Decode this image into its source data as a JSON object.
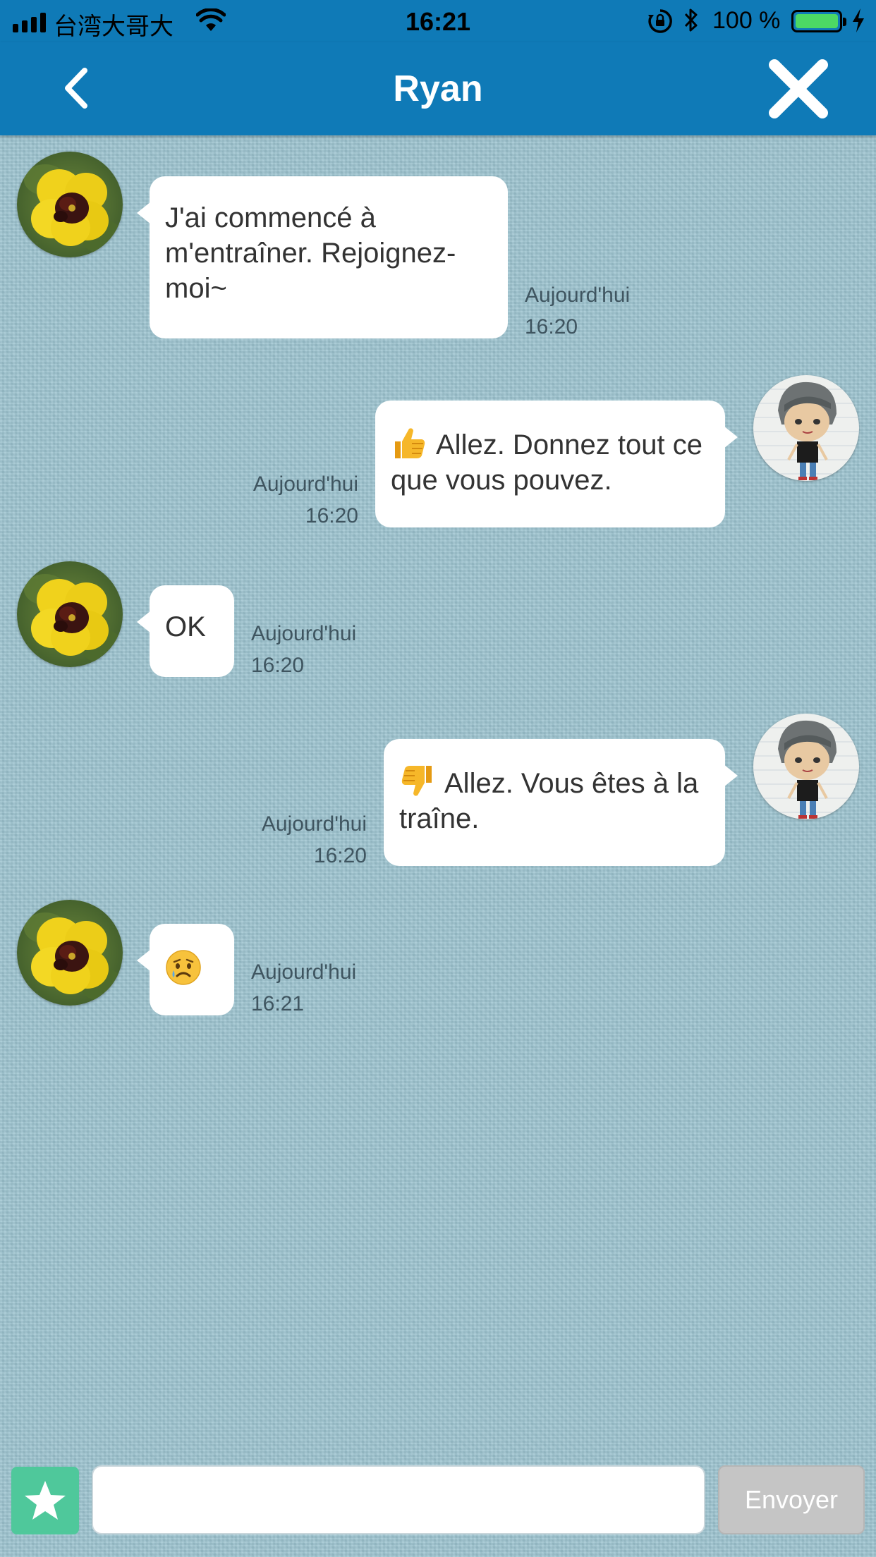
{
  "status_bar": {
    "carrier": "台湾大哥大",
    "time": "16:21",
    "battery_percent": "100 %",
    "battery_level": 1.0,
    "icons": [
      "signal-icon",
      "wifi-icon",
      "rotation-lock-icon",
      "bluetooth-icon",
      "battery-icon",
      "charging-icon"
    ]
  },
  "nav": {
    "title": "Ryan",
    "back_icon": "chevron-left-icon",
    "close_icon": "close-icon"
  },
  "messages": [
    {
      "side": "left",
      "avatar": "flower-avatar",
      "text": "J'ai commencé à m'entraîner. Rejoignez-moi~",
      "date": "Aujourd'hui",
      "time": "16:20"
    },
    {
      "side": "right",
      "avatar": "drawing-avatar",
      "emoji": "thumbs-up-icon",
      "text": "Allez. Donnez tout ce que vous pouvez.",
      "date": "Aujourd'hui",
      "time": "16:20"
    },
    {
      "side": "left",
      "avatar": "flower-avatar",
      "text": "OK",
      "date": "Aujourd'hui",
      "time": "16:20"
    },
    {
      "side": "right",
      "avatar": "drawing-avatar",
      "emoji": "thumbs-down-icon",
      "text": "Allez. Vous êtes à la traîne.",
      "date": "Aujourd'hui",
      "time": "16:20"
    },
    {
      "side": "left",
      "avatar": "flower-avatar",
      "emoji": "sad-face-icon",
      "text": "",
      "date": "Aujourd'hui",
      "time": "16:21"
    }
  ],
  "input_bar": {
    "star_icon": "star-icon",
    "input_value": "",
    "input_placeholder": "",
    "send_label": "Envoyer"
  },
  "colors": {
    "header": "#0f7ab7",
    "chat_background": "#9dc4d0",
    "bubble": "#ffffff",
    "star_button": "#4fc89b",
    "send_button": "#c5c5c5"
  }
}
